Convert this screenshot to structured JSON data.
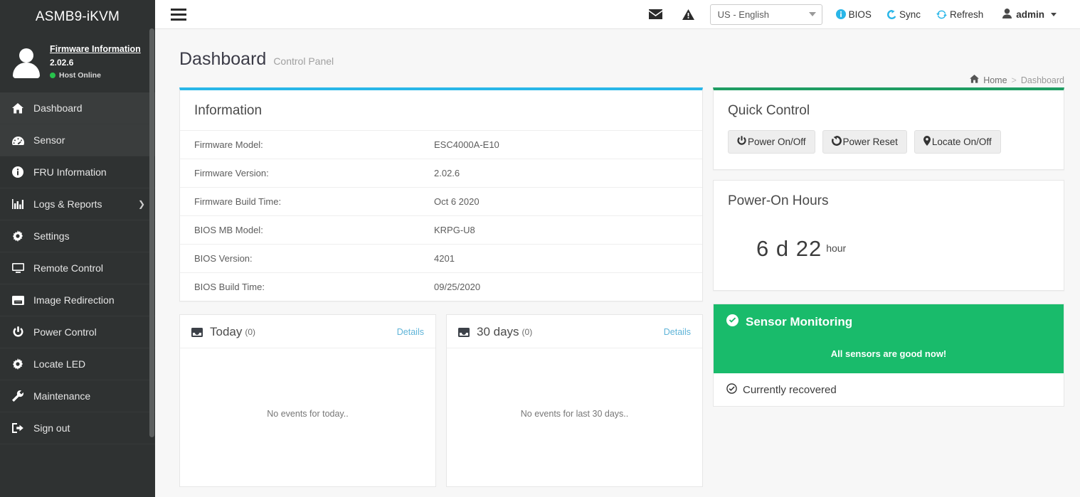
{
  "sidebar": {
    "brand": "ASMB9-iKVM",
    "user": {
      "firmware_link": "Firmware Information",
      "firmware_version": "2.02.6",
      "host_status": "Host Online",
      "online_color": "#27c24c"
    },
    "items": [
      {
        "label": "Dashboard",
        "icon": "home-icon",
        "active": true,
        "has_submenu": false
      },
      {
        "label": "Sensor",
        "icon": "gauge-icon",
        "active": true,
        "has_submenu": false
      },
      {
        "label": "FRU Information",
        "icon": "info-icon",
        "active": false,
        "has_submenu": false
      },
      {
        "label": "Logs & Reports",
        "icon": "chart-bar-icon",
        "active": false,
        "has_submenu": true
      },
      {
        "label": "Settings",
        "icon": "gear-icon",
        "active": false,
        "has_submenu": false
      },
      {
        "label": "Remote Control",
        "icon": "monitor-icon",
        "active": false,
        "has_submenu": false
      },
      {
        "label": "Image Redirection",
        "icon": "disk-icon",
        "active": false,
        "has_submenu": false
      },
      {
        "label": "Power Control",
        "icon": "power-icon",
        "active": false,
        "has_submenu": false
      },
      {
        "label": "Locate LED",
        "icon": "gear-icon",
        "active": false,
        "has_submenu": false
      },
      {
        "label": "Maintenance",
        "icon": "wrench-icon",
        "active": false,
        "has_submenu": false
      },
      {
        "label": "Sign out",
        "icon": "signout-icon",
        "active": false,
        "has_submenu": false
      }
    ]
  },
  "topbar": {
    "menu_toggle": "hamburger-icon",
    "mail_icon": "envelope-icon",
    "alert_icon": "warning-triangle-icon",
    "language": {
      "selected": "US - English"
    },
    "bios_label": "BIOS",
    "sync_label": "Sync",
    "refresh_label": "Refresh",
    "user_label": "admin",
    "accent_color": "#29b6e8"
  },
  "page": {
    "title": "Dashboard",
    "subtitle": "Control Panel",
    "breadcrumb": {
      "home": "Home",
      "separator": ">",
      "current": "Dashboard"
    }
  },
  "information": {
    "title": "Information",
    "accent_color": "#29b6e8",
    "rows": [
      {
        "key": "Firmware Model:",
        "value": "ESC4000A-E10"
      },
      {
        "key": "Firmware Version:",
        "value": "2.02.6"
      },
      {
        "key": "Firmware Build Time:",
        "value": "Oct 6 2020"
      },
      {
        "key": "BIOS MB Model:",
        "value": "KRPG-U8"
      },
      {
        "key": "BIOS Version:",
        "value": "4201"
      },
      {
        "key": "BIOS Build Time:",
        "value": "09/25/2020"
      }
    ]
  },
  "quick_control": {
    "title": "Quick Control",
    "accent_color": "#1f9d63",
    "buttons": [
      {
        "label": "Power On/Off",
        "icon": "power-icon"
      },
      {
        "label": "Power Reset",
        "icon": "reset-icon"
      },
      {
        "label": "Locate On/Off",
        "icon": "map-pin-icon"
      }
    ]
  },
  "power_on_hours": {
    "title": "Power-On Hours",
    "value": "6 d 22",
    "unit": "hour"
  },
  "events": [
    {
      "title": "Today",
      "count": "(0)",
      "details_label": "Details",
      "empty_text": "No events for today..",
      "icon": "inbox-icon"
    },
    {
      "title": "30 days",
      "count": "(0)",
      "details_label": "Details",
      "empty_text": "No events for last 30 days..",
      "icon": "inbox-icon"
    }
  ],
  "sensor_monitoring": {
    "title": "Sensor Monitoring",
    "status_message": "All sensors are good now!",
    "footer_text": "Currently recovered",
    "banner_color": "#19bb6b",
    "header_icon": "check-circle-icon",
    "footer_icon": "check-circle-icon"
  }
}
